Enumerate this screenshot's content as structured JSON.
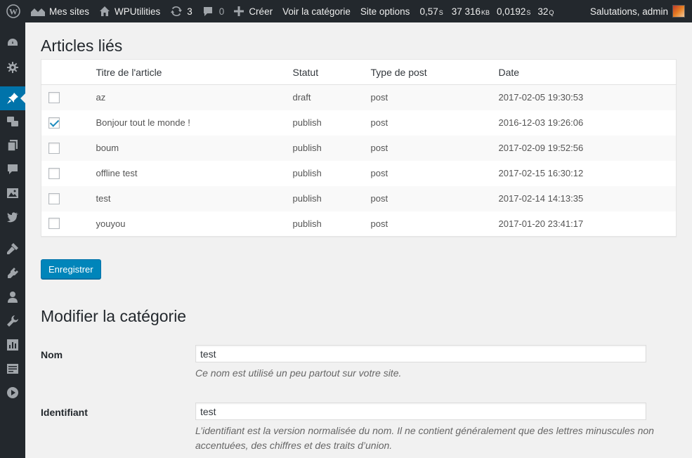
{
  "adminbar": {
    "my_sites": "Mes sites",
    "site_name": "WPUtilities",
    "updates_count": "3",
    "comments_count": "0",
    "create": "Créer",
    "view_category": "Voir la catégorie",
    "site_options": "Site options",
    "qm_time": "0,57",
    "qm_time_unit": "S",
    "qm_memory": "37 316",
    "qm_memory_unit": "KB",
    "qm_db_time": "0,0192",
    "qm_db_time_unit": "S",
    "qm_queries": "32",
    "qm_queries_unit": "Q",
    "greeting": "Salutations, admin"
  },
  "sidebar": {
    "icons": [
      "dashboard-icon",
      "settings-icon",
      "posts-icon",
      "media-translation-icon",
      "pages-icon",
      "comments-icon",
      "media-icon",
      "twitter-icon",
      "appearance-icon",
      "plugins-icon",
      "users-icon",
      "tools-icon",
      "analytics-icon",
      "forms-icon",
      "video-icon"
    ],
    "active": "posts-icon"
  },
  "linked_articles": {
    "title": "Articles liés",
    "columns": [
      "Titre de l'article",
      "Statut",
      "Type de post",
      "Date"
    ],
    "rows": [
      {
        "checked": false,
        "title": "az",
        "status": "draft",
        "type": "post",
        "date": "2017-02-05 19:30:53"
      },
      {
        "checked": true,
        "title": "Bonjour tout le monde !",
        "status": "publish",
        "type": "post",
        "date": "2016-12-03 19:26:06"
      },
      {
        "checked": false,
        "title": "boum",
        "status": "publish",
        "type": "post",
        "date": "2017-02-09 19:52:56"
      },
      {
        "checked": false,
        "title": "offline test",
        "status": "publish",
        "type": "post",
        "date": "2017-02-15 16:30:12"
      },
      {
        "checked": false,
        "title": "test",
        "status": "publish",
        "type": "post",
        "date": "2017-02-14 14:13:35"
      },
      {
        "checked": false,
        "title": "youyou",
        "status": "publish",
        "type": "post",
        "date": "2017-01-20 23:41:17"
      }
    ],
    "save_label": "Enregistrer"
  },
  "edit_category": {
    "title": "Modifier la catégorie",
    "name_label": "Nom",
    "name_value": "test",
    "name_desc": "Ce nom est utilisé un peu partout sur votre site.",
    "slug_label": "Identifiant",
    "slug_value": "test",
    "slug_desc": "L’identifiant est la version normalisée du nom. Il ne contient généralement que des lettres minuscules non accentuées, des chiffres et des traits d’union."
  },
  "colors": {
    "adminbar_bg": "#23282d",
    "accent": "#0073aa",
    "button": "#0085ba"
  }
}
